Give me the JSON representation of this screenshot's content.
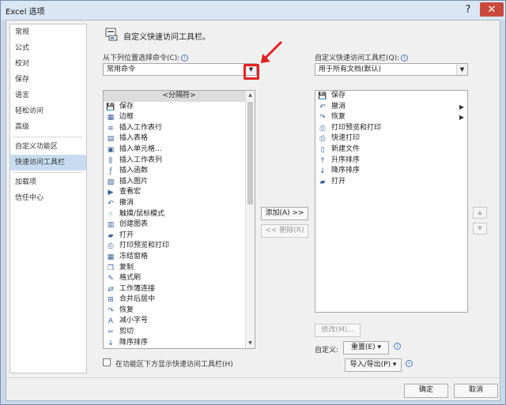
{
  "window": {
    "title": "Excel 选项",
    "help": "?",
    "close": "✕"
  },
  "sidebar": {
    "group1": [
      "常规",
      "公式",
      "校对",
      "保存",
      "语言",
      "轻松访问",
      "高级"
    ],
    "group2": [
      "自定义功能区",
      "快速访问工具栏"
    ],
    "group3": [
      "加载项",
      "信任中心"
    ],
    "selected": "快速访问工具栏"
  },
  "heading": "自定义快速访问工具栏。",
  "choose": {
    "label": "从下列位置选择命令(C):",
    "value": "常用命令"
  },
  "target": {
    "label": "自定义快速访问工具栏(Q):",
    "value": "用于所有文档(默认)"
  },
  "commands": [
    {
      "label": "<分隔符>",
      "icon": "",
      "sub": false,
      "sep": true
    },
    {
      "label": "保存",
      "icon": "save-icon",
      "sub": false
    },
    {
      "label": "边框",
      "icon": "border-icon",
      "sub": true
    },
    {
      "label": "插入工作表行",
      "icon": "insert-row-icon",
      "sub": false
    },
    {
      "label": "插入表格",
      "icon": "table-icon",
      "sub": false
    },
    {
      "label": "插入单元格...",
      "icon": "insert-cell-icon",
      "sub": false
    },
    {
      "label": "插入工作表列",
      "icon": "insert-column-icon",
      "sub": false
    },
    {
      "label": "插入函数",
      "icon": "function-icon",
      "sub": false
    },
    {
      "label": "插入图片",
      "icon": "picture-icon",
      "sub": false
    },
    {
      "label": "查看宏",
      "icon": "macro-icon",
      "sub": false
    },
    {
      "label": "撤消",
      "icon": "undo-icon",
      "sub": true
    },
    {
      "label": "触摸/鼠标模式",
      "icon": "touch-icon",
      "sub": true
    },
    {
      "label": "创建图表",
      "icon": "chart-icon",
      "sub": false
    },
    {
      "label": "打开",
      "icon": "folder-icon",
      "sub": false
    },
    {
      "label": "打印预览和打印",
      "icon": "print-preview-icon",
      "sub": false
    },
    {
      "label": "冻结窗格",
      "icon": "freeze-icon",
      "sub": true
    },
    {
      "label": "复制",
      "icon": "copy-icon",
      "sub": false
    },
    {
      "label": "格式刷",
      "icon": "format-painter-icon",
      "sub": false
    },
    {
      "label": "工作簿连接",
      "icon": "connection-icon",
      "sub": false
    },
    {
      "label": "合并后居中",
      "icon": "merge-icon",
      "sub": false
    },
    {
      "label": "恢复",
      "icon": "redo-icon",
      "sub": true
    },
    {
      "label": "减小字号",
      "icon": "font-smaller-icon",
      "sub": false
    },
    {
      "label": "剪切",
      "icon": "cut-icon",
      "sub": false
    },
    {
      "label": "降序排序",
      "icon": "sort-desc-icon",
      "sub": false
    }
  ],
  "toolbar_items": [
    {
      "label": "保存",
      "icon": "save-icon",
      "sub": false
    },
    {
      "label": "撤消",
      "icon": "undo-icon",
      "sub": true
    },
    {
      "label": "恢复",
      "icon": "redo-icon",
      "sub": true
    },
    {
      "label": "打印预览和打印",
      "icon": "print-preview-icon",
      "sub": false
    },
    {
      "label": "快速打印",
      "icon": "quick-print-icon",
      "sub": false
    },
    {
      "label": "新建文件",
      "icon": "new-file-icon",
      "sub": false
    },
    {
      "label": "升序排序",
      "icon": "sort-asc-icon",
      "sub": false
    },
    {
      "label": "降序排序",
      "icon": "sort-desc-icon",
      "sub": false
    },
    {
      "label": "打开",
      "icon": "folder-icon",
      "sub": false
    }
  ],
  "buttons": {
    "add": "添加(A) >>",
    "remove": "<< 删除(R)",
    "modify": "修改(M)...",
    "customize_label": "自定义:",
    "reset": "重置(E) ▾",
    "import_export": "导入/导出(P) ▾",
    "ok": "确定",
    "cancel": "取消",
    "up": "▲",
    "down": "▼"
  },
  "checkbox_label": "在功能区下方显示快速访问工具栏(H)",
  "colors": {
    "selected": "#c7dcf0",
    "highlight": "#e52020",
    "close": "#c94a3c"
  }
}
